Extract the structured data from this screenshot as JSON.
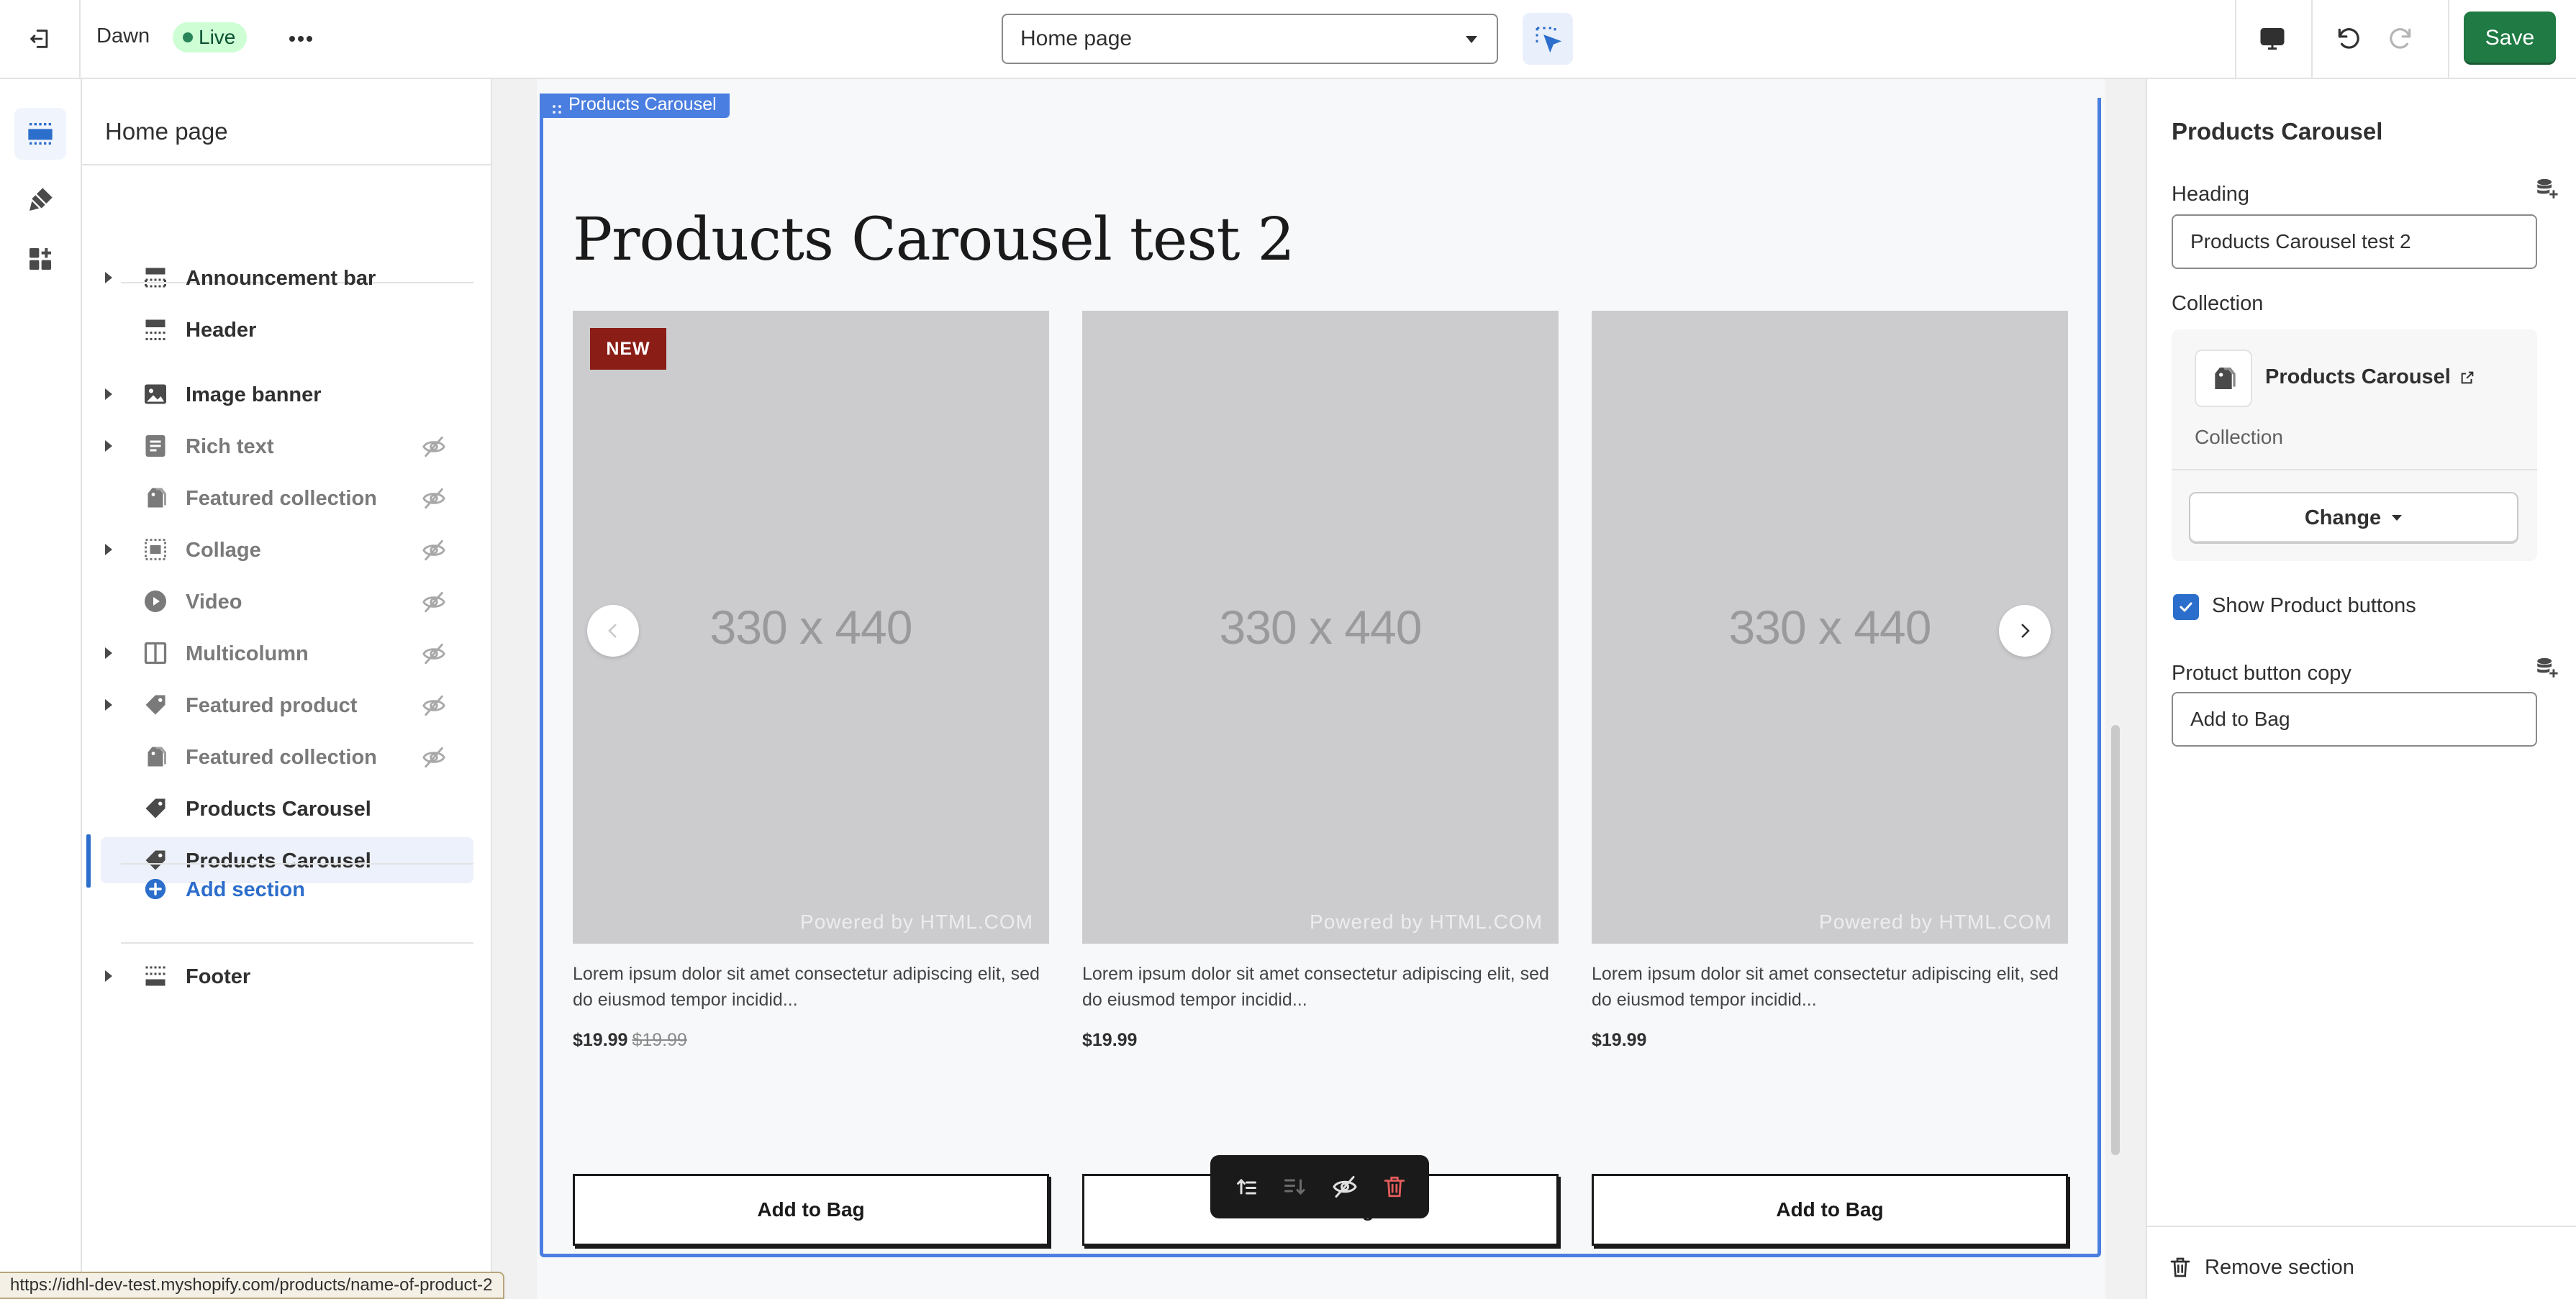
{
  "topbar": {
    "theme_name": "Dawn",
    "live_label": "Live",
    "page_select": "Home page",
    "save_label": "Save",
    "colors": {
      "save": "#1f7a43",
      "live_bg": "#cdfed4",
      "accent": "#2c6ecb"
    }
  },
  "sidebar": {
    "title": "Home page",
    "sections": [
      {
        "label": "Announcement bar",
        "icon": "announcement-bar-icon",
        "expandable": true,
        "hidden": false
      },
      {
        "label": "Header",
        "icon": "header-icon",
        "expandable": false,
        "hidden": false
      },
      {
        "label": "Image banner",
        "icon": "image-icon",
        "expandable": true,
        "hidden": false
      },
      {
        "label": "Rich text",
        "icon": "text-icon",
        "expandable": true,
        "hidden": true
      },
      {
        "label": "Featured collection",
        "icon": "collection-icon",
        "expandable": false,
        "hidden": true
      },
      {
        "label": "Collage",
        "icon": "collage-icon",
        "expandable": true,
        "hidden": true
      },
      {
        "label": "Video",
        "icon": "play-icon",
        "expandable": false,
        "hidden": true
      },
      {
        "label": "Multicolumn",
        "icon": "columns-icon",
        "expandable": true,
        "hidden": true
      },
      {
        "label": "Featured product",
        "icon": "tag-icon",
        "expandable": true,
        "hidden": true
      },
      {
        "label": "Featured collection",
        "icon": "collection-icon",
        "expandable": false,
        "hidden": true
      },
      {
        "label": "Products Carousel",
        "icon": "tag-icon",
        "expandable": false,
        "hidden": false
      },
      {
        "label": "Products Carousel",
        "icon": "tag-icon",
        "expandable": false,
        "hidden": false,
        "selected": true
      }
    ],
    "add_section": "Add section",
    "footer": "Footer"
  },
  "preview": {
    "section_tag": "Products Carousel",
    "heading": "Products Carousel test 2",
    "products": [
      {
        "badge": "NEW",
        "placeholder": "330 x 440",
        "powered": "Powered by HTML.COM",
        "description": "Lorem ipsum dolor sit amet consectetur adipiscing elit, sed do eiusmod tempor incidid...",
        "price": "$19.99",
        "compare_price": "$19.99",
        "button": "Add to Bag"
      },
      {
        "badge": "",
        "placeholder": "330 x 440",
        "powered": "Powered by HTML.COM",
        "description": "Lorem ipsum dolor sit amet consectetur adipiscing elit, sed do eiusmod tempor incidid...",
        "price": "$19.99",
        "compare_price": "",
        "button": "Add to Bag"
      },
      {
        "badge": "",
        "placeholder": "330 x 440",
        "powered": "Powered by HTML.COM",
        "description": "Lorem ipsum dolor sit amet consectetur adipiscing elit, sed do eiusmod tempor incidid...",
        "price": "$19.99",
        "compare_price": "",
        "button": "Add to Bag"
      }
    ],
    "status_url": "https://idhl-dev-test.myshopify.com/products/name-of-product-2"
  },
  "settings": {
    "title": "Products Carousel",
    "heading_label": "Heading",
    "heading_value": "Products Carousel test 2",
    "collection_label": "Collection",
    "collection_name": "Products Carousel",
    "collection_sub": "Collection",
    "change_label": "Change",
    "show_buttons_label": "Show Product buttons",
    "show_buttons_checked": true,
    "button_copy_label": "Protuct button copy",
    "button_copy_value": "Add to Bag",
    "remove_label": "Remove section"
  }
}
